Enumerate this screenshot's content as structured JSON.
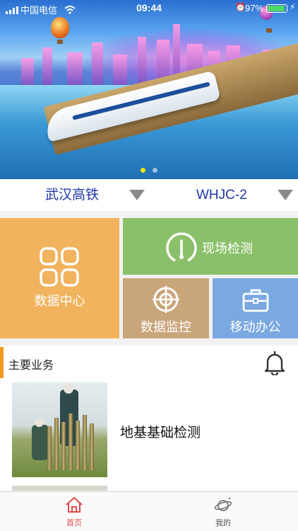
{
  "status_bar": {
    "carrier": "中国电信",
    "time": "09:44",
    "battery_percent": "97%"
  },
  "banner": {
    "slide_count": 2,
    "active_slide": 1
  },
  "selectors": {
    "line": "武汉高铁",
    "device": "WHJC-2"
  },
  "tiles": {
    "data_center": "数据中心",
    "site_inspection": "现场检测",
    "data_monitoring": "数据监控",
    "mobile_office": "移动办公"
  },
  "section": {
    "title": "主要业务",
    "items": [
      {
        "title": "地基基础检测"
      }
    ]
  },
  "tabbar": {
    "home": "首页",
    "mine": "我的"
  },
  "colors": {
    "selector_text": "#1f37a6",
    "tile_data_center": "#f1b35e",
    "tile_site_inspection": "#8bc06a",
    "tile_data_monitoring": "#c9a57a",
    "tile_mobile_office": "#7aa8e0",
    "section_accent": "#f39a1f",
    "tab_active": "#e24a4a",
    "tab_inactive": "#555555"
  }
}
